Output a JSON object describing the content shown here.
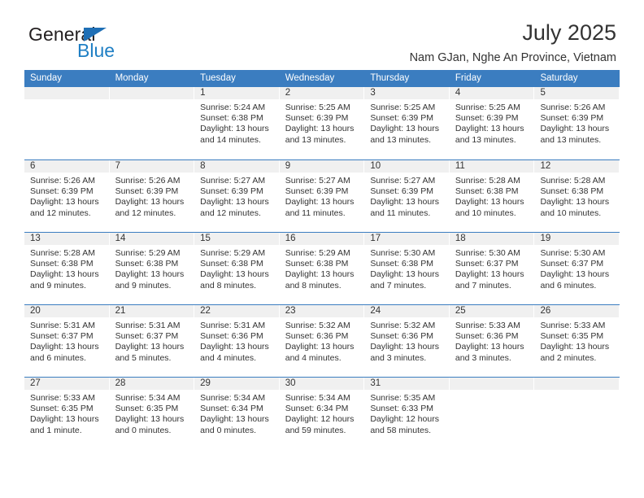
{
  "brand": {
    "word_one": "General",
    "word_two": "Blue",
    "triangle_color": "#1f6fb5",
    "blue_color": "#1f7fc4"
  },
  "header": {
    "title": "July 2025",
    "subtitle": "Nam GJan, Nghe An Province, Vietnam"
  },
  "theme": {
    "header_blue": "#3b7dc0",
    "day_band_gray": "#f0f0f0",
    "text": "#333333"
  },
  "calendar": {
    "weekdays": [
      "Sunday",
      "Monday",
      "Tuesday",
      "Wednesday",
      "Thursday",
      "Friday",
      "Saturday"
    ],
    "weeks": [
      [
        {
          "day": "",
          "empty": true
        },
        {
          "day": "",
          "empty": true
        },
        {
          "day": "1",
          "sunrise": "Sunrise: 5:24 AM",
          "sunset": "Sunset: 6:38 PM",
          "daylight": "Daylight: 13 hours and 14 minutes."
        },
        {
          "day": "2",
          "sunrise": "Sunrise: 5:25 AM",
          "sunset": "Sunset: 6:39 PM",
          "daylight": "Daylight: 13 hours and 13 minutes."
        },
        {
          "day": "3",
          "sunrise": "Sunrise: 5:25 AM",
          "sunset": "Sunset: 6:39 PM",
          "daylight": "Daylight: 13 hours and 13 minutes."
        },
        {
          "day": "4",
          "sunrise": "Sunrise: 5:25 AM",
          "sunset": "Sunset: 6:39 PM",
          "daylight": "Daylight: 13 hours and 13 minutes."
        },
        {
          "day": "5",
          "sunrise": "Sunrise: 5:26 AM",
          "sunset": "Sunset: 6:39 PM",
          "daylight": "Daylight: 13 hours and 13 minutes."
        }
      ],
      [
        {
          "day": "6",
          "sunrise": "Sunrise: 5:26 AM",
          "sunset": "Sunset: 6:39 PM",
          "daylight": "Daylight: 13 hours and 12 minutes."
        },
        {
          "day": "7",
          "sunrise": "Sunrise: 5:26 AM",
          "sunset": "Sunset: 6:39 PM",
          "daylight": "Daylight: 13 hours and 12 minutes."
        },
        {
          "day": "8",
          "sunrise": "Sunrise: 5:27 AM",
          "sunset": "Sunset: 6:39 PM",
          "daylight": "Daylight: 13 hours and 12 minutes."
        },
        {
          "day": "9",
          "sunrise": "Sunrise: 5:27 AM",
          "sunset": "Sunset: 6:39 PM",
          "daylight": "Daylight: 13 hours and 11 minutes."
        },
        {
          "day": "10",
          "sunrise": "Sunrise: 5:27 AM",
          "sunset": "Sunset: 6:39 PM",
          "daylight": "Daylight: 13 hours and 11 minutes."
        },
        {
          "day": "11",
          "sunrise": "Sunrise: 5:28 AM",
          "sunset": "Sunset: 6:38 PM",
          "daylight": "Daylight: 13 hours and 10 minutes."
        },
        {
          "day": "12",
          "sunrise": "Sunrise: 5:28 AM",
          "sunset": "Sunset: 6:38 PM",
          "daylight": "Daylight: 13 hours and 10 minutes."
        }
      ],
      [
        {
          "day": "13",
          "sunrise": "Sunrise: 5:28 AM",
          "sunset": "Sunset: 6:38 PM",
          "daylight": "Daylight: 13 hours and 9 minutes."
        },
        {
          "day": "14",
          "sunrise": "Sunrise: 5:29 AM",
          "sunset": "Sunset: 6:38 PM",
          "daylight": "Daylight: 13 hours and 9 minutes."
        },
        {
          "day": "15",
          "sunrise": "Sunrise: 5:29 AM",
          "sunset": "Sunset: 6:38 PM",
          "daylight": "Daylight: 13 hours and 8 minutes."
        },
        {
          "day": "16",
          "sunrise": "Sunrise: 5:29 AM",
          "sunset": "Sunset: 6:38 PM",
          "daylight": "Daylight: 13 hours and 8 minutes."
        },
        {
          "day": "17",
          "sunrise": "Sunrise: 5:30 AM",
          "sunset": "Sunset: 6:38 PM",
          "daylight": "Daylight: 13 hours and 7 minutes."
        },
        {
          "day": "18",
          "sunrise": "Sunrise: 5:30 AM",
          "sunset": "Sunset: 6:37 PM",
          "daylight": "Daylight: 13 hours and 7 minutes."
        },
        {
          "day": "19",
          "sunrise": "Sunrise: 5:30 AM",
          "sunset": "Sunset: 6:37 PM",
          "daylight": "Daylight: 13 hours and 6 minutes."
        }
      ],
      [
        {
          "day": "20",
          "sunrise": "Sunrise: 5:31 AM",
          "sunset": "Sunset: 6:37 PM",
          "daylight": "Daylight: 13 hours and 6 minutes."
        },
        {
          "day": "21",
          "sunrise": "Sunrise: 5:31 AM",
          "sunset": "Sunset: 6:37 PM",
          "daylight": "Daylight: 13 hours and 5 minutes."
        },
        {
          "day": "22",
          "sunrise": "Sunrise: 5:31 AM",
          "sunset": "Sunset: 6:36 PM",
          "daylight": "Daylight: 13 hours and 4 minutes."
        },
        {
          "day": "23",
          "sunrise": "Sunrise: 5:32 AM",
          "sunset": "Sunset: 6:36 PM",
          "daylight": "Daylight: 13 hours and 4 minutes."
        },
        {
          "day": "24",
          "sunrise": "Sunrise: 5:32 AM",
          "sunset": "Sunset: 6:36 PM",
          "daylight": "Daylight: 13 hours and 3 minutes."
        },
        {
          "day": "25",
          "sunrise": "Sunrise: 5:33 AM",
          "sunset": "Sunset: 6:36 PM",
          "daylight": "Daylight: 13 hours and 3 minutes."
        },
        {
          "day": "26",
          "sunrise": "Sunrise: 5:33 AM",
          "sunset": "Sunset: 6:35 PM",
          "daylight": "Daylight: 13 hours and 2 minutes."
        }
      ],
      [
        {
          "day": "27",
          "sunrise": "Sunrise: 5:33 AM",
          "sunset": "Sunset: 6:35 PM",
          "daylight": "Daylight: 13 hours and 1 minute."
        },
        {
          "day": "28",
          "sunrise": "Sunrise: 5:34 AM",
          "sunset": "Sunset: 6:35 PM",
          "daylight": "Daylight: 13 hours and 0 minutes."
        },
        {
          "day": "29",
          "sunrise": "Sunrise: 5:34 AM",
          "sunset": "Sunset: 6:34 PM",
          "daylight": "Daylight: 13 hours and 0 minutes."
        },
        {
          "day": "30",
          "sunrise": "Sunrise: 5:34 AM",
          "sunset": "Sunset: 6:34 PM",
          "daylight": "Daylight: 12 hours and 59 minutes."
        },
        {
          "day": "31",
          "sunrise": "Sunrise: 5:35 AM",
          "sunset": "Sunset: 6:33 PM",
          "daylight": "Daylight: 12 hours and 58 minutes."
        },
        {
          "day": "",
          "empty": true
        },
        {
          "day": "",
          "empty": true
        }
      ]
    ]
  }
}
